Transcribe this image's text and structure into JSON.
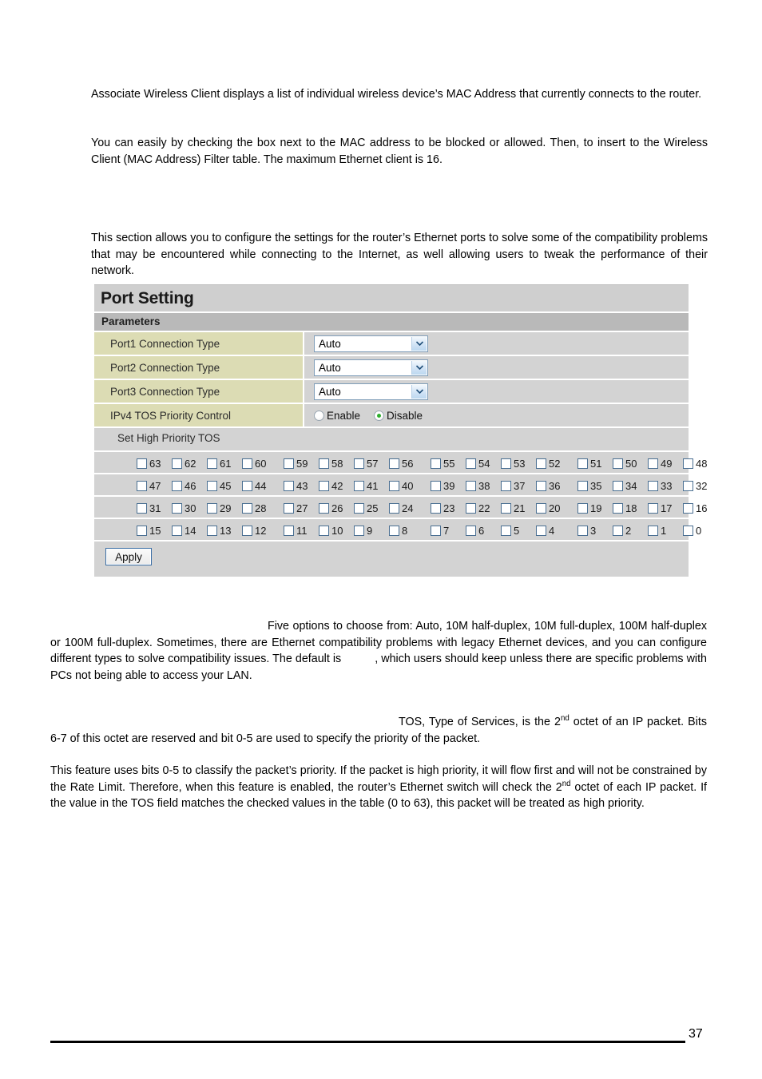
{
  "document": {
    "paragraphs": {
      "p1": "Associate Wireless Client displays a list of individual wireless device’s MAC Address that currently connects to the router.",
      "p2": "You can easily by checking the box next to the MAC address to be blocked or allowed. Then, to insert to the Wireless Client (MAC Address) Filter table.  The maximum Ethernet client is 16.",
      "p3": "This section allows you to configure the settings for the router’s Ethernet ports to solve some of the compatibility problems that may be encountered while connecting to the Internet, as well allowing users to tweak the performance of their network.",
      "p4_a": "Five options to choose from: Auto, 10M half-duplex, 10M full-duplex, 100M half-duplex or 100M full-duplex. Sometimes, there are Ethernet compatibility problems with legacy Ethernet devices, and you can configure different types to solve compatibility issues. The default is",
      "p4_b": ", which users should keep unless there are specific problems with PCs not being able to access your LAN.",
      "p5_a": "TOS, Type of Services, is the 2",
      "p5_sup": "nd",
      "p5_b": " octet of an IP packet. Bits 6-7 of this octet are reserved and bit 0-5 are used to specify the priority  of the packet.",
      "p6_a": "This feature uses bits 0-5 to classify the packet’s priority. If the packet is high priority, it will flow first and will not be constrained by the Rate Limit.  Therefore, when this feature is enabled, the router’s Ethernet switch will check the 2",
      "p6_sup": "nd",
      "p6_b": " octet of each IP packet. If the value in the TOS field matches the checked values in the table (0 to 63), this packet will be treated as high priority."
    },
    "footer": {
      "page_number": "37"
    }
  },
  "panel": {
    "title": "Port Setting",
    "subhead": "Parameters",
    "rows": [
      {
        "label": "Port1 Connection Type",
        "value": "Auto"
      },
      {
        "label": "Port2 Connection Type",
        "value": "Auto"
      },
      {
        "label": "Port3 Connection Type",
        "value": "Auto"
      }
    ],
    "select_options": [
      "Auto",
      "10M half-duplex",
      "10M full-duplex",
      "100M half-duplex",
      "100M full-duplex"
    ],
    "tos_control": {
      "label": "IPv4 TOS Priority Control",
      "enable_label": "Enable",
      "disable_label": "Disable",
      "selected": "Disable"
    },
    "tos_section_label": "Set High Priority TOS",
    "tos_rows": [
      [
        63,
        62,
        61,
        60,
        59,
        58,
        57,
        56,
        55,
        54,
        53,
        52,
        51,
        50,
        49,
        48
      ],
      [
        47,
        46,
        45,
        44,
        43,
        42,
        41,
        40,
        39,
        38,
        37,
        36,
        35,
        34,
        33,
        32
      ],
      [
        31,
        30,
        29,
        28,
        27,
        26,
        25,
        24,
        23,
        22,
        21,
        20,
        19,
        18,
        17,
        16
      ],
      [
        15,
        14,
        13,
        12,
        11,
        10,
        9,
        8,
        7,
        6,
        5,
        4,
        3,
        2,
        1,
        0
      ]
    ],
    "tos_checked": [],
    "apply_label": "Apply",
    "colors": {
      "panel_bg": "#d3d3d3",
      "title_bg": "#cfcfcf",
      "subhead_bg": "#b9b9b9",
      "label_bg": "#dcdcb4",
      "select_border": "#7f9db9",
      "radio_on": "#2faf2f",
      "button_border": "#3a6ea5"
    }
  }
}
